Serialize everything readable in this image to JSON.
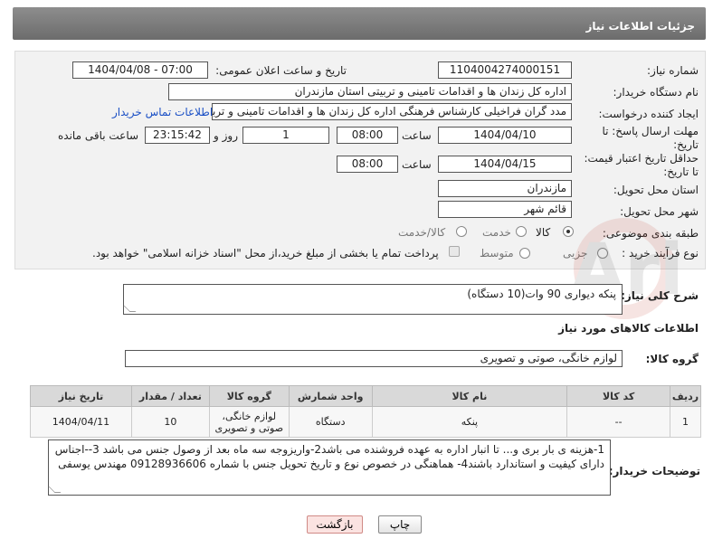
{
  "header": {
    "title": "جزئیات اطلاعات نیاز"
  },
  "form": {
    "need_number_label": "شماره نیاز:",
    "need_number": "1104004274000151",
    "announce_label": "تاریخ و ساعت اعلان عمومی:",
    "announce_value": "1404/04/08 - 07:00",
    "buyer_org_label": "نام دستگاه خریدار:",
    "buyer_org": "اداره کل زندان ها و اقدامات تامینی و تربیتی استان مازندران",
    "creator_label": "ایجاد کننده درخواست:",
    "creator": "مدد گران فراخیلی کارشناس فرهنگی اداره کل زندان ها و اقدامات تامینی و تربیتی استان مازندران",
    "contact_link": "اطلاعات تماس خریدار",
    "reply_deadline_label": "مهلت ارسال پاسخ: تا تاریخ:",
    "reply_date": "1404/04/10",
    "time_label": "ساعت",
    "reply_time": "08:00",
    "day_count": "1",
    "day_label": "روز و",
    "remaining_time": "23:15:42",
    "remaining_label": "ساعت باقی مانده",
    "price_validity_label": "حداقل تاریخ اعتبار قیمت: تا تاریخ:",
    "price_date": "1404/04/15",
    "price_time": "08:00",
    "province_label": "استان محل تحویل:",
    "province": "مازندران",
    "city_label": "شهر محل تحویل:",
    "city": "قائم شهر",
    "category_label": "طبقه بندی موضوعی:",
    "cat_options": [
      "کالا",
      "خدمت",
      "کالا/خدمت"
    ],
    "process_label": "نوع فرآیند خرید :",
    "process_options": [
      "جزیی",
      "متوسط"
    ],
    "payment_note": "پرداخت تمام یا بخشی از مبلغ خرید،از محل \"اسناد خزانه اسلامی\" خواهد بود."
  },
  "summary": {
    "label": "شرح کلی نیاز:",
    "value": "پنکه دیواری 90 وات(10 دستگاه)"
  },
  "goods_section": {
    "title": "اطلاعات کالاهای مورد نیاز",
    "group_label": "گروه کالا:",
    "group_value": "لوازم خانگی، صوتی و تصویری"
  },
  "table": {
    "headers": [
      "ردیف",
      "کد کالا",
      "نام کالا",
      "واحد شمارش",
      "گروه کالا",
      "تعداد / مقدار",
      "تاریخ نیاز"
    ],
    "rows": [
      [
        "1",
        "--",
        "پنکه",
        "دستگاه",
        "لوازم خانگی، صوتی و تصویری",
        "10",
        "1404/04/11"
      ]
    ]
  },
  "buyer_notes": {
    "label": "توضیحات خریدار:",
    "value": "1-هزینه ی بار بری و... تا انبار اداره به عهده فروشنده می باشد2-واریزوجه سه ماه بعد از وصول جنس می باشد 3--اجناس دارای کیفیت و استاندارد باشند4- هماهنگی در خصوص نوع و تاریخ تحویل جنس با شماره 09128936606 مهندس یوسفی"
  },
  "buttons": {
    "print": "چاپ",
    "back": "بازگشت"
  },
  "watermark": "AriaTender.net"
}
